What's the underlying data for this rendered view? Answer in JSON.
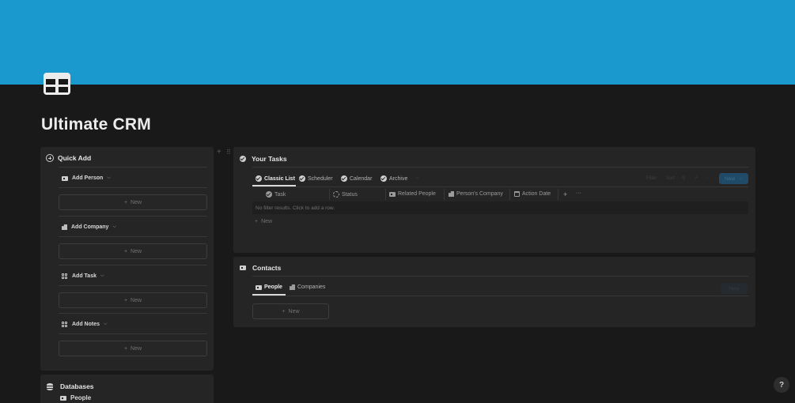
{
  "page": {
    "title": "Ultimate CRM",
    "icon": "table-icon",
    "cover_color": "#1a99cf"
  },
  "quick_add": {
    "title": "Quick Add",
    "sections": [
      {
        "label": "Add Person",
        "icon": "contact-card-icon",
        "new_label": "New"
      },
      {
        "label": "Add Company",
        "icon": "building-icon",
        "new_label": "New"
      },
      {
        "label": "Add Task",
        "icon": "grid-icon",
        "new_label": "New"
      },
      {
        "label": "Add Notes",
        "icon": "grid-icon",
        "new_label": "New"
      }
    ]
  },
  "databases": {
    "title": "Databases",
    "items": [
      {
        "label": "People",
        "icon": "contact-card-icon"
      }
    ]
  },
  "tasks": {
    "title": "Your Tasks",
    "tabs": [
      {
        "label": "Classic List",
        "active": true
      },
      {
        "label": "Scheduler",
        "active": false
      },
      {
        "label": "Calendar",
        "active": false
      },
      {
        "label": "Archive",
        "active": false
      }
    ],
    "columns": [
      "Task",
      "Status",
      "Related People",
      "Person's Company",
      "Action Date"
    ],
    "empty_text": "No filter results. Click to add a row.",
    "add_row_label": "New",
    "toolbar": {
      "filter": "Filter",
      "sort": "Sort",
      "new": "New"
    }
  },
  "contacts": {
    "title": "Contacts",
    "tabs": [
      {
        "label": "People",
        "active": true
      },
      {
        "label": "Companies",
        "active": false
      }
    ],
    "new_label": "New",
    "toolbar_new": "New"
  },
  "help": {
    "label": "?"
  }
}
